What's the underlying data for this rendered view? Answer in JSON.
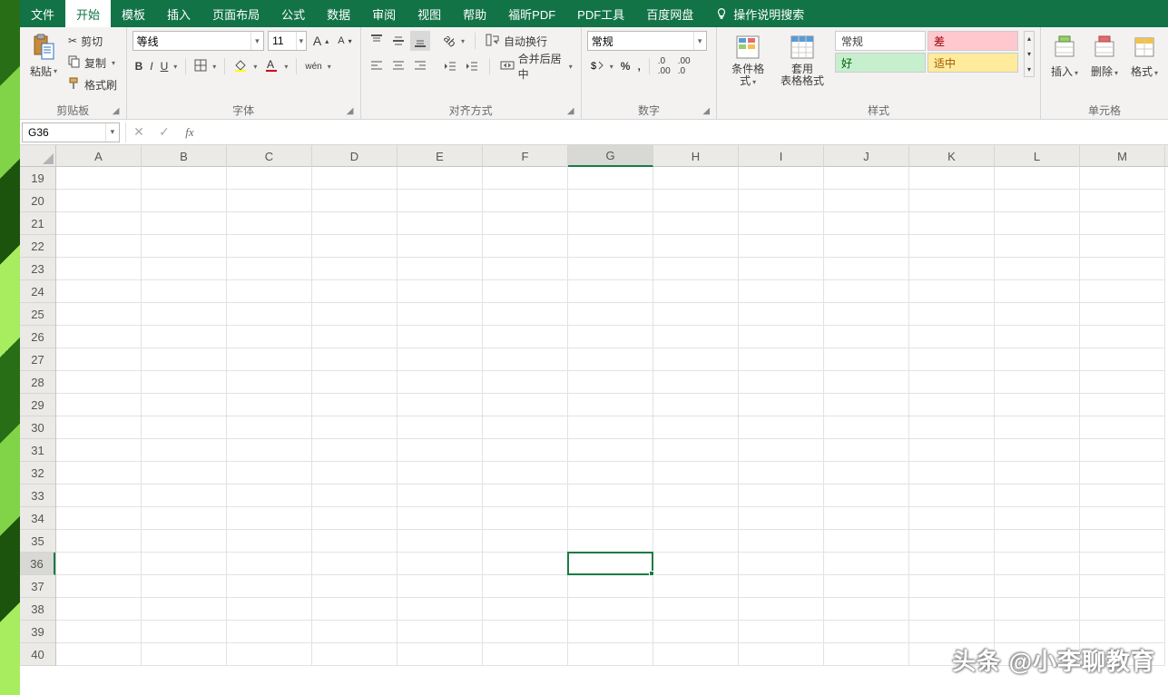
{
  "menu": {
    "file": "文件",
    "home": "开始",
    "template": "模板",
    "insert": "插入",
    "layout": "页面布局",
    "formula": "公式",
    "data": "数据",
    "review": "审阅",
    "view": "视图",
    "help": "帮助",
    "foxit": "福昕PDF",
    "pdftool": "PDF工具",
    "baidu": "百度网盘",
    "tellme": "操作说明搜索"
  },
  "clipboard": {
    "paste": "粘贴",
    "cut": "剪切",
    "copy": "复制",
    "painter": "格式刷",
    "label": "剪贴板"
  },
  "font": {
    "name": "等线",
    "size": "11",
    "bold": "B",
    "italic": "I",
    "underline": "U",
    "pinyin": "wén",
    "label": "字体"
  },
  "align": {
    "wrap": "自动换行",
    "merge": "合并后居中",
    "label": "对齐方式"
  },
  "number": {
    "format": "常规",
    "percent": "%",
    "comma": ",",
    "label": "数字"
  },
  "styles": {
    "condfmt": "条件格式",
    "tablefmt": "套用\n表格格式",
    "s_normal": "常规",
    "s_bad": "差",
    "s_good": "好",
    "s_neutral": "适中",
    "label": "样式"
  },
  "cells": {
    "insert": "插入",
    "delete": "删除",
    "format": "格式",
    "label": "单元格"
  },
  "fbar": {
    "cellref": "G36"
  },
  "grid": {
    "cols": [
      "A",
      "B",
      "C",
      "D",
      "E",
      "F",
      "G",
      "H",
      "I",
      "J",
      "K",
      "L",
      "M"
    ],
    "rowStart": 19,
    "rowEnd": 40,
    "selectedCol": "G",
    "selectedRow": 36
  },
  "watermark": "头条 @小李聊教育"
}
